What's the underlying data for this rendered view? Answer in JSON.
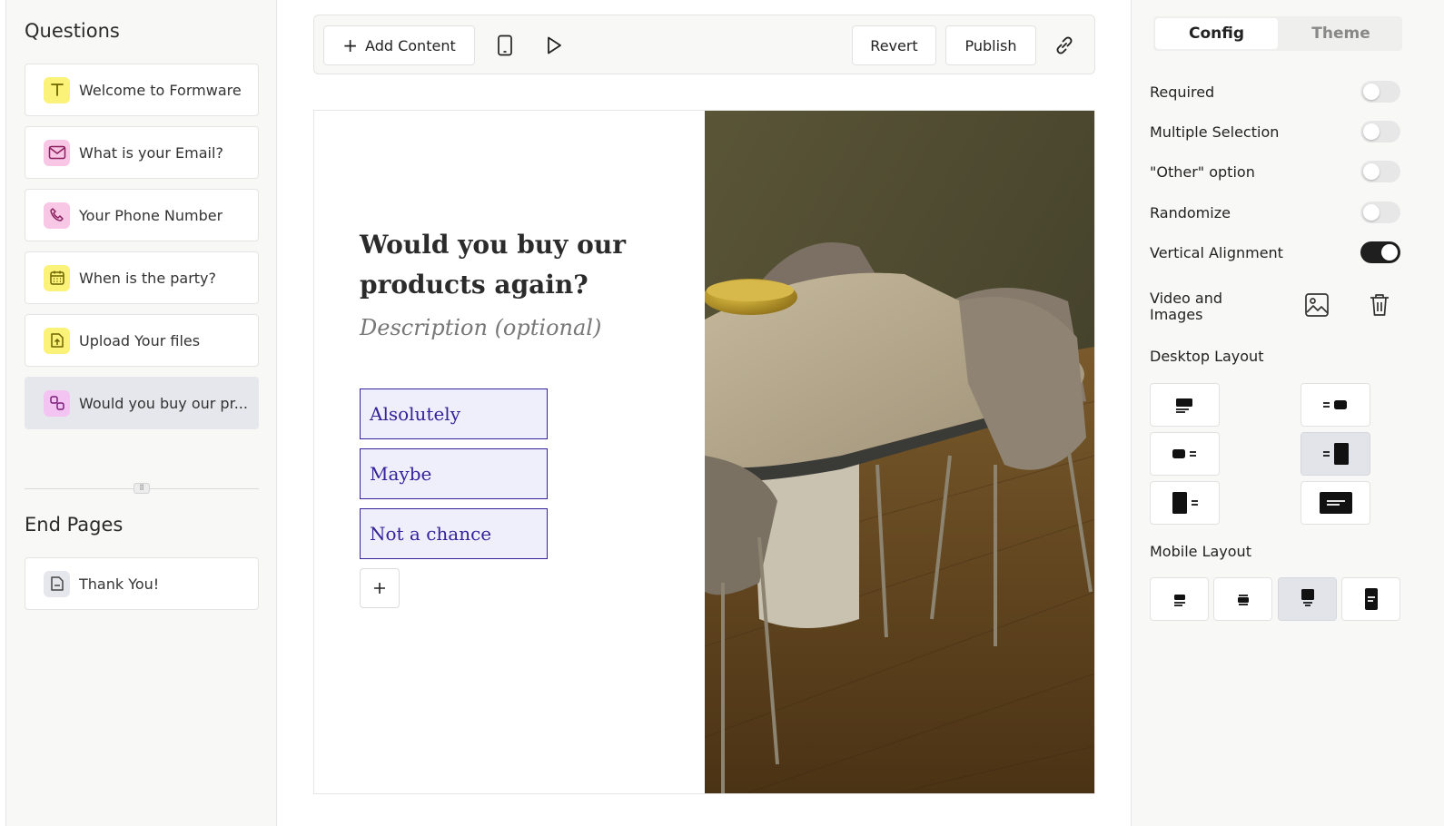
{
  "sidebar": {
    "questions_title": "Questions",
    "questions": [
      {
        "label": "Welcome to Formware",
        "icon": "text-icon",
        "color": "#fbf27a"
      },
      {
        "label": "What is your Email?",
        "icon": "mail-icon",
        "color": "#f9c7e6"
      },
      {
        "label": "Your Phone Number",
        "icon": "phone-icon",
        "color": "#f9c7e6"
      },
      {
        "label": "When is the party?",
        "icon": "calendar-icon",
        "color": "#fbf27a"
      },
      {
        "label": "Upload Your files",
        "icon": "upload-file-icon",
        "color": "#fbf27a"
      },
      {
        "label": "Would you buy our pr...",
        "icon": "choice-icon",
        "color": "#f3c4f2"
      }
    ],
    "end_pages_title": "End Pages",
    "end_pages": [
      {
        "label": "Thank You!",
        "icon": "page-icon",
        "color": "#e6e7ec"
      }
    ]
  },
  "toolbar": {
    "add_content_label": "Add Content",
    "revert_label": "Revert",
    "publish_label": "Publish"
  },
  "canvas": {
    "question_title": "Would you buy our products again?",
    "description_placeholder": "Description (optional)",
    "choices": [
      "Alsolutely",
      "Maybe",
      "Not a chance"
    ]
  },
  "panel": {
    "tabs": [
      "Config",
      "Theme"
    ],
    "active_tab": "Config",
    "toggles": [
      {
        "label": "Required",
        "on": false
      },
      {
        "label": "Multiple Selection",
        "on": false
      },
      {
        "label": "\"Other\" option",
        "on": false
      },
      {
        "label": "Randomize",
        "on": false
      },
      {
        "label": "Vertical Alignment",
        "on": true
      }
    ],
    "media_label": "Video and Images",
    "desktop_layout_title": "Desktop Layout",
    "mobile_layout_title": "Mobile Layout",
    "active_desktop_layout": "split-right-image",
    "active_mobile_layout": "stacked-image-top-large"
  },
  "colors": {
    "accent": "#35219a",
    "choice_bg": "#efeffb",
    "active_item": "#e6e7ec",
    "toggle_on": "#1f1f1f"
  }
}
